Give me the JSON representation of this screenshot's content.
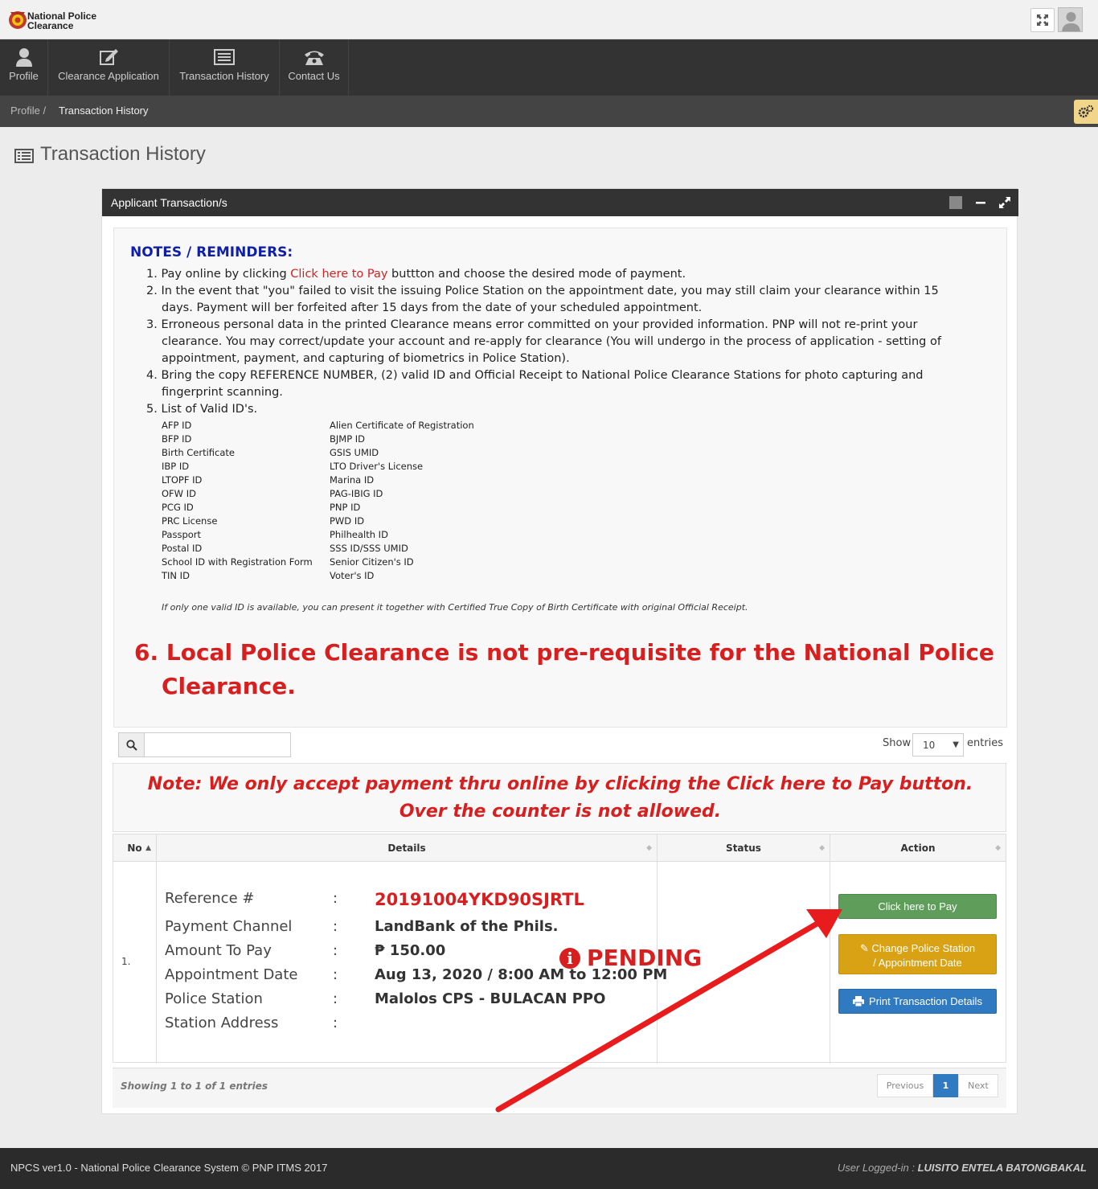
{
  "app": {
    "logo_line1": "National Police",
    "logo_line2": "Clearance"
  },
  "nav": [
    {
      "label": "Profile",
      "icon": "user-icon"
    },
    {
      "label": "Clearance Application",
      "icon": "edit-icon"
    },
    {
      "label": "Transaction History",
      "icon": "list-icon"
    },
    {
      "label": "Contact Us",
      "icon": "phone-icon"
    }
  ],
  "breadcrumb": {
    "root": "Profile /",
    "current": "Transaction History"
  },
  "page_title": "Transaction History",
  "panel": {
    "title": "Applicant Transaction/s"
  },
  "notes": {
    "title": "NOTES / REMINDERS:",
    "n1_pre": "1. Pay online by clicking ",
    "n1_link": "Click here to Pay",
    "n1_post": " buttton and choose the desired mode of payment.",
    "n2a": "2. In the event that \"you\" failed to visit the issuing Police Station on the appointment date, you may still claim your clearance within 15",
    "n2b": "days. Payment will ber forfeited after 15 days from the date of your scheduled appointment.",
    "n3a": "3. Erroneous personal data in the printed Clearance means error committed on your provided information. PNP will not re-print your",
    "n3b": "clearance. You may correct/update your account and re-apply for clearance (You will undergo in the process of application - setting of",
    "n3c": "appointment, payment, and capturing of biometrics in Police Station).",
    "n4a": "4. Bring the copy REFERENCE NUMBER, (2) valid ID and Official Receipt to National Police Clearance Stations for photo capturing and",
    "n4b": "fingerprint scanning.",
    "n5": "5. List of Valid ID's.",
    "ids_left": [
      "AFP ID",
      "BFP ID",
      "Birth Certificate",
      "IBP ID",
      "LTOPF ID",
      "OFW ID",
      "PCG ID",
      "PRC License",
      "Passport",
      "Postal ID",
      "School ID with Registration Form",
      "TIN ID"
    ],
    "ids_right": [
      "Alien Certificate of Registration",
      "BJMP ID",
      "GSIS UMID",
      "LTO Driver's License",
      "Marina ID",
      "PAG-IBIG ID",
      "PNP ID",
      "PWD ID",
      "Philhealth ID",
      "SSS ID/SSS UMID",
      "Senior Citizen's ID",
      "Voter's ID"
    ],
    "italic_note": "If only one valid ID is available, you can present it together with Certified True Copy of Birth Certificate with original Official Receipt.",
    "n6a": "6. Local Police Clearance is not pre-requisite for the National Police",
    "n6b": "Clearance."
  },
  "table_controls": {
    "search_placeholder": "",
    "show_label": "Show",
    "show_value": "10",
    "entries_label": "entries"
  },
  "pay_note": {
    "line1": "Note: We only accept payment thru online by clicking the Click here to Pay button.",
    "line2": "Over the counter is not allowed."
  },
  "table": {
    "headers": [
      "No",
      "Details",
      "Status",
      "Action"
    ],
    "row": {
      "no": "1.",
      "labels": [
        "Reference #",
        "Payment Channel",
        "Amount To Pay",
        "Appointment Date",
        "Police Station",
        "Station Address"
      ],
      "colon": ":",
      "reference": "20191004YKD90SJRTL",
      "payment_channel": "LandBank of the Phils.",
      "amount": "₱ 150.00",
      "appointment": "Aug 13, 2020 / 8:00 AM to 12:00 PM",
      "station": "Malolos CPS - BULACAN PPO",
      "address": "",
      "status": "PENDING",
      "status_icon": "i"
    },
    "actions": {
      "pay": "Click here to Pay",
      "change_line1": "Change Police Station",
      "change_line2": "/ Appointment Date",
      "print": "Print Transaction Details"
    }
  },
  "pagination": {
    "showing": "Showing 1 to 1 of 1 entries",
    "previous": "Previous",
    "page": "1",
    "next": "Next"
  },
  "footer": {
    "left": "NPCS ver1.0 - National Police Clearance System © PNP ITMS 2017",
    "right_label": "User Logged-in : ",
    "right_user": "LUISITO ENTELA BATONGBAKAL"
  },
  "colors": {
    "accent_red": "#d81f1f",
    "notes_blue": "#0f1fa8",
    "pay_green": "#5f9e5a",
    "change_orange": "#d9a214",
    "print_blue": "#2f7ac0"
  }
}
